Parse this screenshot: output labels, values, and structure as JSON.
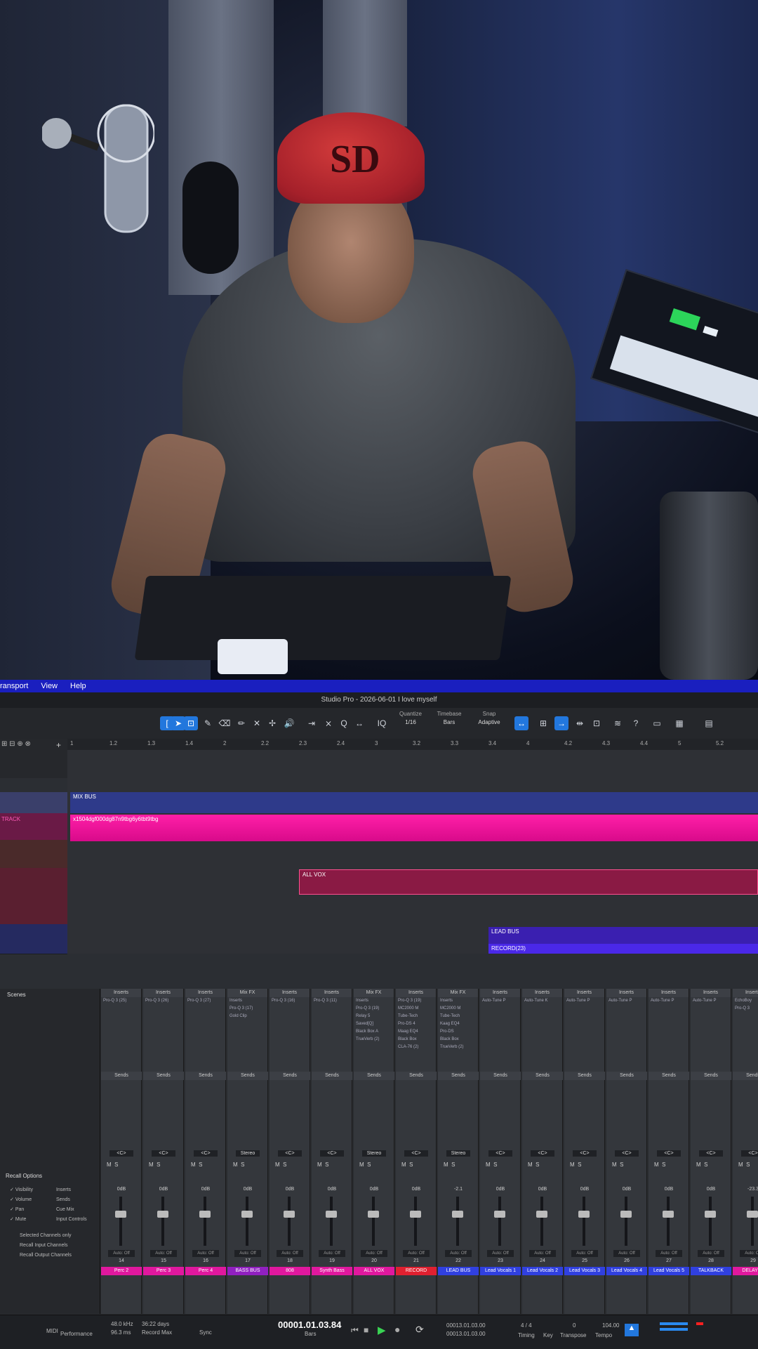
{
  "daw": {
    "menu": [
      "ransport",
      "View",
      "Help"
    ],
    "title": "Studio Pro - 2026-06-01 I love myself",
    "toolbar": {
      "quantize_label": "Quantize",
      "quantize_value": "1/16",
      "timebase_label": "Timebase",
      "timebase_value": "Bars",
      "snap_label": "Snap",
      "snap_value": "Adaptive"
    },
    "ruler": [
      "1",
      "1.2",
      "1.3",
      "1.4",
      "2",
      "2.2",
      "2.3",
      "2.4",
      "3",
      "3.2",
      "3.3",
      "3.4",
      "4",
      "4.2",
      "4.3",
      "4.4",
      "5",
      "5.2"
    ],
    "tracks": [
      {
        "name": "MIX BUS",
        "clip": "MIX BUS"
      },
      {
        "name": "TRACK",
        "clip": "x1504dgf000dg87n9tbg6y6tbt9tbg"
      },
      {
        "name": "",
        "clip": ""
      },
      {
        "name": "",
        "clip": "ALL VOX"
      },
      {
        "name": "",
        "clip": ""
      },
      {
        "name": "",
        "clip": "LEAD BUS",
        "clip2": "RECORD(23)"
      }
    ],
    "scenes_label": "Scenes",
    "recall": {
      "title": "Recall Options",
      "items": [
        "Visibility",
        "Inserts",
        "Volume",
        "Sends",
        "Pan",
        "Cue Mix",
        "Mute",
        "Input Controls"
      ],
      "options": [
        "Selected Channels only",
        "Recall Input Channels",
        "Recall Output Channels"
      ]
    },
    "channels": [
      {
        "num": "14",
        "name": "Perc 2",
        "header": "Inserts",
        "inserts": [
          "Pro-Q 3 (25)"
        ],
        "db": "0dB",
        "pan": "<C>",
        "color": "#e0189e"
      },
      {
        "num": "15",
        "name": "Perc 3",
        "header": "Inserts",
        "inserts": [
          "Pro-Q 3 (26)"
        ],
        "db": "0dB",
        "pan": "<C>",
        "color": "#e0189e"
      },
      {
        "num": "16",
        "name": "Perc 4",
        "header": "Inserts",
        "inserts": [
          "Pro-Q 3 (27)"
        ],
        "db": "0dB",
        "pan": "<C>",
        "color": "#e0189e"
      },
      {
        "num": "17",
        "name": "BASS BUS",
        "header": "Mix FX",
        "inserts": [
          "Inserts",
          "Pro-Q 3 (17)",
          "Gold Clip"
        ],
        "db": "0dB",
        "pan": "Stereo",
        "color": "#9020c0"
      },
      {
        "num": "18",
        "name": "808",
        "header": "Inserts",
        "inserts": [
          "Pro-Q 3 (16)"
        ],
        "db": "0dB",
        "pan": "<C>",
        "color": "#e0189e"
      },
      {
        "num": "19",
        "name": "Synth Bass",
        "header": "Inserts",
        "inserts": [
          "Pro-Q 3 (11)"
        ],
        "db": "0dB",
        "pan": "<C>",
        "color": "#e0189e"
      },
      {
        "num": "20",
        "name": "ALL VOX",
        "header": "Mix FX",
        "inserts": [
          "Inserts",
          "Pro-Q 3 (19)",
          "Relay 5",
          "Saved[Q]",
          "Black Box A",
          "TrueVerb (2)"
        ],
        "db": "0dB",
        "pan": "Stereo",
        "color": "#e0189e"
      },
      {
        "num": "21",
        "name": "RECORD",
        "header": "Inserts",
        "inserts": [
          "Pro-Q 3 (19)",
          "MC2000 M",
          "Tube-Tech",
          "Pro-DS 4",
          "Maag EQ4",
          "Black Box",
          "CLA-76 (2)"
        ],
        "db": "0dB",
        "pan": "<C>",
        "color": "#e02030"
      },
      {
        "num": "22",
        "name": "LEAD BUS",
        "header": "Mix FX",
        "inserts": [
          "Inserts",
          "MC2000 M",
          "Tube-Tech",
          "Kaag EQ4",
          "Pro-DS",
          "Black Box",
          "TrueVerb (2)"
        ],
        "db": "-2.1",
        "pan": "Stereo",
        "color": "#3040e0"
      },
      {
        "num": "23",
        "name": "Lead Vocals 1",
        "header": "Inserts",
        "inserts": [
          "Auto-Tune P"
        ],
        "db": "0dB",
        "pan": "<C>",
        "color": "#3040e0"
      },
      {
        "num": "24",
        "name": "Lead Vocals 2",
        "header": "Inserts",
        "inserts": [
          "Auto-Tune K"
        ],
        "db": "0dB",
        "pan": "<C>",
        "color": "#3040e0"
      },
      {
        "num": "25",
        "name": "Lead Vocals 3",
        "header": "Inserts",
        "inserts": [
          "Auto-Tune P"
        ],
        "db": "0dB",
        "pan": "<C>",
        "color": "#3040e0"
      },
      {
        "num": "26",
        "name": "Lead Vocals 4",
        "header": "Inserts",
        "inserts": [
          "Auto-Tune P"
        ],
        "db": "0dB",
        "pan": "<C>",
        "color": "#3040e0"
      },
      {
        "num": "27",
        "name": "Lead Vocals 5",
        "header": "Inserts",
        "inserts": [
          "Auto-Tune P"
        ],
        "db": "0dB",
        "pan": "<C>",
        "color": "#3040e0"
      },
      {
        "num": "28",
        "name": "TALKBACK",
        "header": "Inserts",
        "inserts": [
          "Auto-Tune P"
        ],
        "db": "0dB",
        "pan": "<C>",
        "color": "#3040e0"
      },
      {
        "num": "29",
        "name": "DELAY .R",
        "header": "Inserts",
        "inserts": [
          "EchoBoy",
          "Pro-Q 3"
        ],
        "db": "-23.3",
        "pan": "<C>",
        "color": "#e0189e"
      }
    ],
    "sends_label": "Sends",
    "auto_label": "Auto: Off",
    "transport": {
      "midi": "MIDI",
      "performance": "Performance",
      "samplerate": "48.0 kHz",
      "samplerate2": "96.3 ms",
      "record_days": "36:22 days",
      "record_max": "Record Max",
      "sync": "Sync",
      "time": "00001.01.03.84",
      "time_unit": "Bars",
      "loop_l": "00013.01.03.00",
      "loop_r": "00013.01.03.00",
      "signature": "4 / 4",
      "timing": "Timing",
      "key": "Key",
      "transpose": "0",
      "transpose_label": "Transpose",
      "tempo": "104.00",
      "tempo_label": "Tempo"
    }
  }
}
